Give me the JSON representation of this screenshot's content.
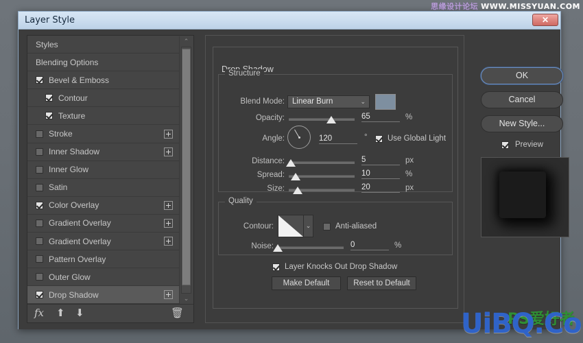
{
  "window": {
    "title": "Layer Style",
    "close_label": "✕"
  },
  "watermarks": {
    "top_cn": "思缘设计论坛",
    "top_en": "WWW.MISSYUAN.COM",
    "bottom": "UiBQ.CoM",
    "bottom_logo": "PS爱好者"
  },
  "styles_panel": {
    "items": [
      {
        "label": "Styles",
        "checkbox": null,
        "indent": false,
        "plus": false,
        "selected": false
      },
      {
        "label": "Blending Options",
        "checkbox": null,
        "indent": false,
        "plus": false,
        "selected": false
      },
      {
        "label": "Bevel & Emboss",
        "checkbox": true,
        "indent": false,
        "plus": false,
        "selected": false
      },
      {
        "label": "Contour",
        "checkbox": true,
        "indent": true,
        "plus": false,
        "selected": false
      },
      {
        "label": "Texture",
        "checkbox": true,
        "indent": true,
        "plus": false,
        "selected": false
      },
      {
        "label": "Stroke",
        "checkbox": false,
        "indent": false,
        "plus": true,
        "selected": false
      },
      {
        "label": "Inner Shadow",
        "checkbox": false,
        "indent": false,
        "plus": true,
        "selected": false
      },
      {
        "label": "Inner Glow",
        "checkbox": false,
        "indent": false,
        "plus": false,
        "selected": false
      },
      {
        "label": "Satin",
        "checkbox": false,
        "indent": false,
        "plus": false,
        "selected": false
      },
      {
        "label": "Color Overlay",
        "checkbox": true,
        "indent": false,
        "plus": true,
        "selected": false
      },
      {
        "label": "Gradient Overlay",
        "checkbox": false,
        "indent": false,
        "plus": true,
        "selected": false
      },
      {
        "label": "Gradient Overlay",
        "checkbox": false,
        "indent": false,
        "plus": true,
        "selected": false
      },
      {
        "label": "Pattern Overlay",
        "checkbox": false,
        "indent": false,
        "plus": false,
        "selected": false
      },
      {
        "label": "Outer Glow",
        "checkbox": false,
        "indent": false,
        "plus": false,
        "selected": false
      },
      {
        "label": "Drop Shadow",
        "checkbox": true,
        "indent": false,
        "plus": true,
        "selected": true
      }
    ],
    "toolbar": {
      "fx": "fx",
      "move_up": "⬆",
      "move_down": "⬇",
      "delete": "🗑"
    },
    "scroll_up": "⌃",
    "scroll_down": "⌄"
  },
  "settings": {
    "section_title": "Drop Shadow",
    "structure": {
      "title": "Structure",
      "blend_mode_label": "Blend Mode:",
      "blend_mode_value": "Linear Burn",
      "blend_mode_chevron": "⌄",
      "color": "#7e8fa0",
      "opacity_label": "Opacity:",
      "opacity_value": "65",
      "opacity_unit": "%",
      "opacity_pct": 65,
      "angle_label": "Angle:",
      "angle_value": "120",
      "angle_unit": "°",
      "use_global_light": "Use Global Light",
      "use_global_light_checked": true,
      "distance_label": "Distance:",
      "distance_value": "5",
      "distance_unit": "px",
      "distance_pct": 3,
      "spread_label": "Spread:",
      "spread_value": "10",
      "spread_unit": "%",
      "spread_pct": 10,
      "size_label": "Size:",
      "size_value": "20",
      "size_unit": "px",
      "size_pct": 14
    },
    "quality": {
      "title": "Quality",
      "contour_label": "Contour:",
      "contour_chevron": "⌄",
      "anti_aliased_label": "Anti-aliased",
      "anti_aliased_checked": false,
      "noise_label": "Noise:",
      "noise_value": "0",
      "noise_unit": "%",
      "noise_pct": 0
    },
    "layer_knocks_out_label": "Layer Knocks Out Drop Shadow",
    "layer_knocks_out_checked": true,
    "make_default": "Make Default",
    "reset_to_default": "Reset to Default"
  },
  "right_panel": {
    "ok": "OK",
    "cancel": "Cancel",
    "new_style": "New Style...",
    "preview_label": "Preview",
    "preview_checked": true
  }
}
